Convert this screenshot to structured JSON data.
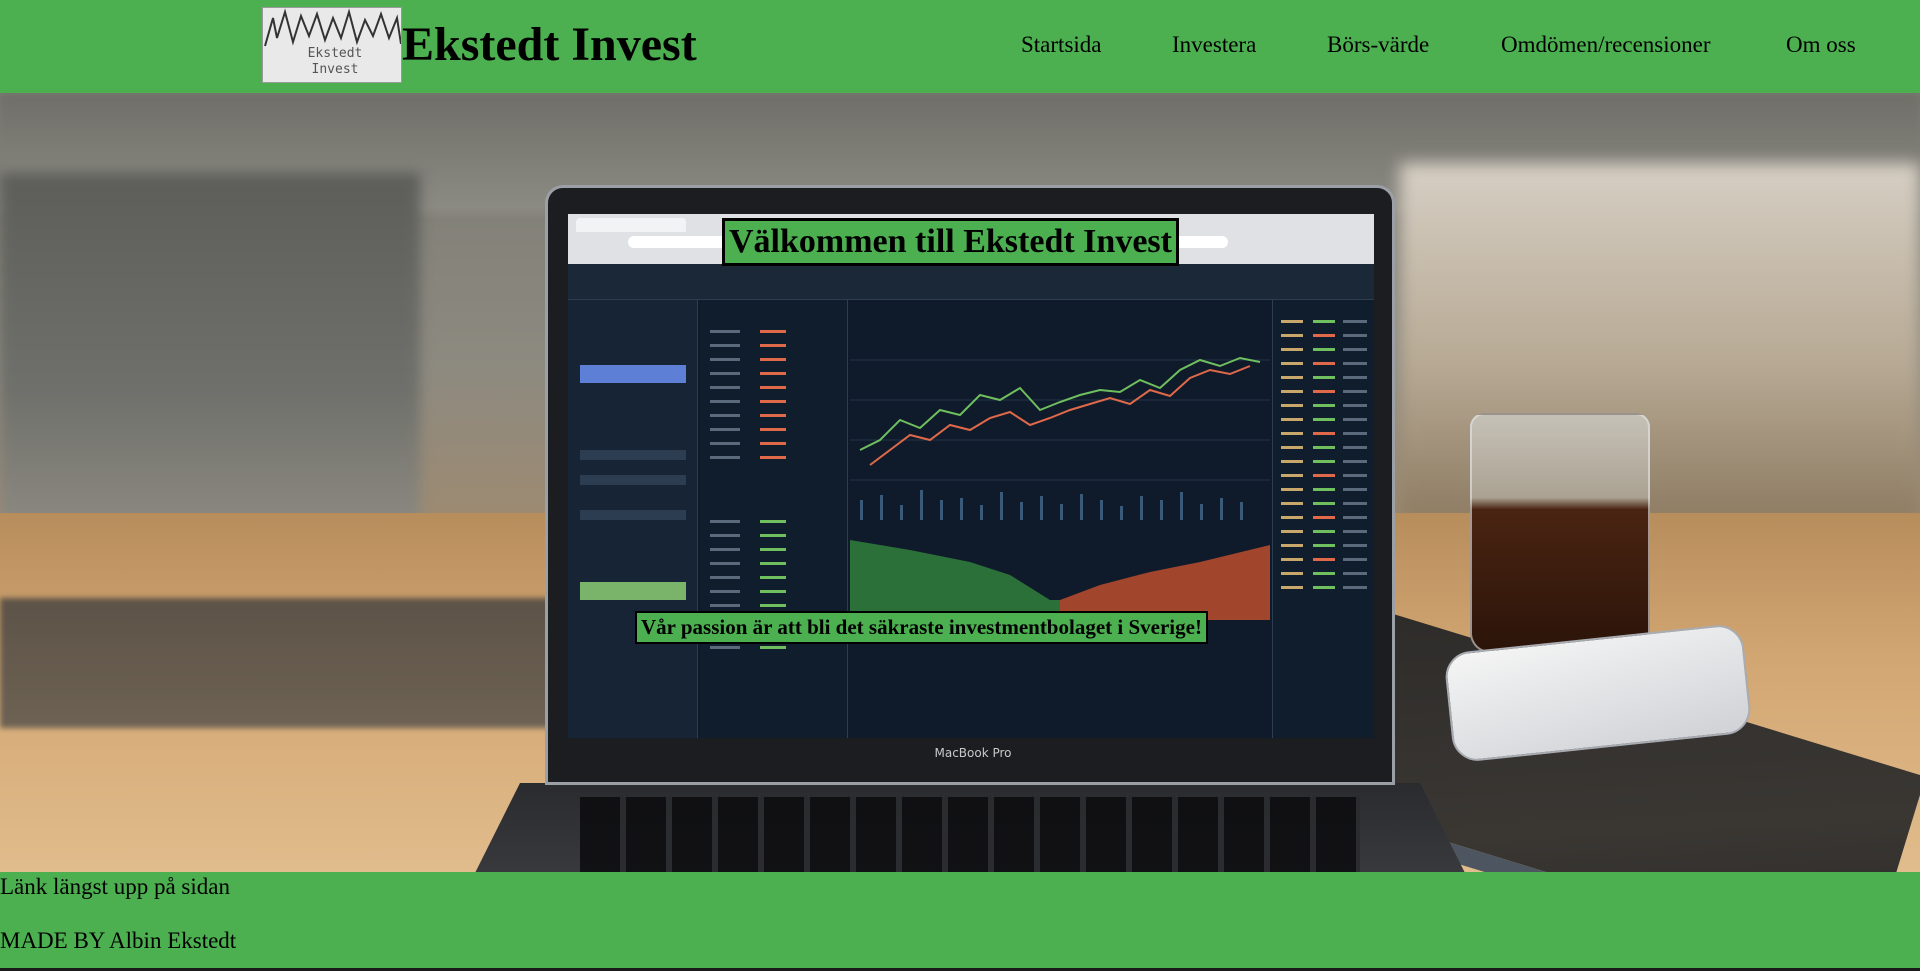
{
  "header": {
    "logo_alt": "Ekstedt Invest logo",
    "logo_text": "Ekstedt\nInvest",
    "site_title": "Ekstedt Invest"
  },
  "nav": {
    "items": [
      {
        "label": "Startsida"
      },
      {
        "label": "Investera"
      },
      {
        "label": "Börs-värde"
      },
      {
        "label": "Omdömen/recensioner"
      },
      {
        "label": "Om oss"
      }
    ]
  },
  "hero": {
    "title": "Välkommen till Ekstedt Invest",
    "subtitle": "Vår passion är att bli det säkraste investmentbolaget i Sverige!",
    "laptop_label": "MacBook Pro"
  },
  "footer": {
    "top_link": "Länk längst upp på sidan",
    "made_by": "MADE BY Albin Ekstedt"
  },
  "colors": {
    "brand_green": "#4caf50",
    "text": "#000000"
  }
}
